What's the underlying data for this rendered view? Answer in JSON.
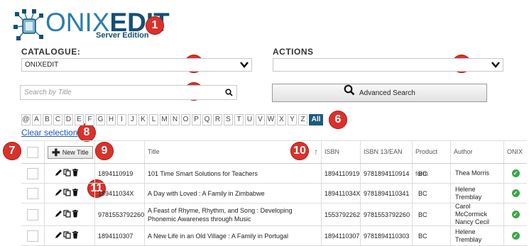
{
  "logo": {
    "text_light": "ONIX",
    "text_bold": "EDIT",
    "subtitle": "Server Edition"
  },
  "catalogue": {
    "label": "CATALOGUE:",
    "selected": "ONIXEDIT"
  },
  "actions": {
    "label": "ACTIONS",
    "selected": ""
  },
  "search": {
    "placeholder": "Search by Title"
  },
  "advanced_search": {
    "label": "Advanced Search"
  },
  "alphabet": [
    "@",
    "A",
    "B",
    "C",
    "D",
    "E",
    "F",
    "G",
    "H",
    "I",
    "J",
    "K",
    "L",
    "M",
    "N",
    "O",
    "P",
    "Q",
    "R",
    "S",
    "T",
    "U",
    "V",
    "W",
    "X",
    "Y",
    "Z"
  ],
  "alphabet_all": "All",
  "clear_selection": "Clear selection",
  "table": {
    "new_title_label": "New Title",
    "columns": [
      "Title",
      "ISBN",
      "ISBN 13/EAN",
      "Product form",
      "Author",
      "ONIX"
    ],
    "rows": [
      {
        "id": "1894110919",
        "title": "101 Time Smart Solutions for Teachers",
        "isbn": "1894110919",
        "ean": "9781894110914",
        "form": "BC",
        "author": "Thea Morris"
      },
      {
        "id": "189411034X",
        "title": "A Day with Loved : A Family in Zimbabwe",
        "isbn": "189411034X",
        "ean": "9781894110341",
        "form": "BC",
        "author": "Helene Tremblay"
      },
      {
        "id": "9781553792260",
        "title": "A Feast of Rhyme, Rhythm, and Song : Developing Phonemic Awareness through Music",
        "isbn": "1553792262",
        "ean": "9781553792260",
        "form": "BC",
        "author": "Carol McCormick\nNancy Cecil"
      },
      {
        "id": "1894110307",
        "title": "A New Life in an Old Village : A Family in Portugal",
        "isbn": "1894110307",
        "ean": "9781894110303",
        "form": "BC",
        "author": "Helene Tremblay"
      }
    ]
  },
  "callouts": [
    "1",
    "2",
    "3",
    "4",
    "5",
    "6",
    "7",
    "8",
    "9",
    "10",
    "11"
  ],
  "colors": {
    "accent": "#1d5b7c",
    "callout": "#d9322c",
    "link": "#1b58c4",
    "ok": "#3aa64a"
  },
  "icons": {
    "edit": "pencil-icon",
    "copy": "copy-icon",
    "delete": "trash-icon",
    "ok": "check-circle-icon",
    "search": "search-icon",
    "sort": "sort-up-arrow-icon"
  }
}
